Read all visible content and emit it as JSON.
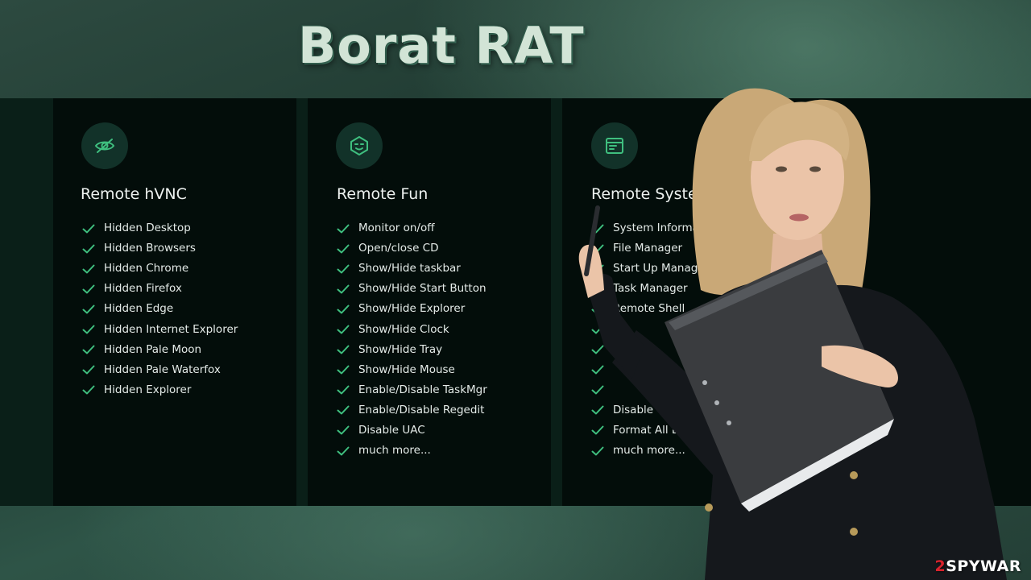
{
  "title": "Borat RAT",
  "watermark": {
    "digit": "2",
    "text": "SPYWAR"
  },
  "columns": [
    {
      "icon": "hidden-eye-icon",
      "title": "Remote hVNC",
      "items": [
        "Hidden Desktop",
        "Hidden Browsers",
        "Hidden Chrome",
        "Hidden Firefox",
        "Hidden Edge",
        "Hidden Internet Explorer",
        "Hidden Pale Moon",
        "Hidden Pale Waterfox",
        "Hidden Explorer"
      ]
    },
    {
      "icon": "smiley-face-icon",
      "title": "Remote Fun",
      "items": [
        "Monitor on/off",
        "Open/close CD",
        "Show/Hide taskbar",
        "Show/Hide Start Button",
        "Show/Hide Explorer",
        "Show/Hide Clock",
        "Show/Hide Tray",
        "Show/Hide Mouse",
        "Enable/Disable TaskMgr",
        "Enable/Disable Regedit",
        "Disable UAC",
        "much more..."
      ]
    },
    {
      "icon": "system-window-icon",
      "title": "Remote System",
      "items": [
        "System Information",
        "File Manager",
        "Start Up Manager",
        "Task Manager",
        "Remote Shell",
        "",
        "",
        "",
        "",
        "Disable WD",
        "Format All Drivers",
        "much more..."
      ]
    }
  ],
  "colors": {
    "accent": "#3fbf7f",
    "panel": "#030d0a",
    "background": "#2d4a40"
  }
}
